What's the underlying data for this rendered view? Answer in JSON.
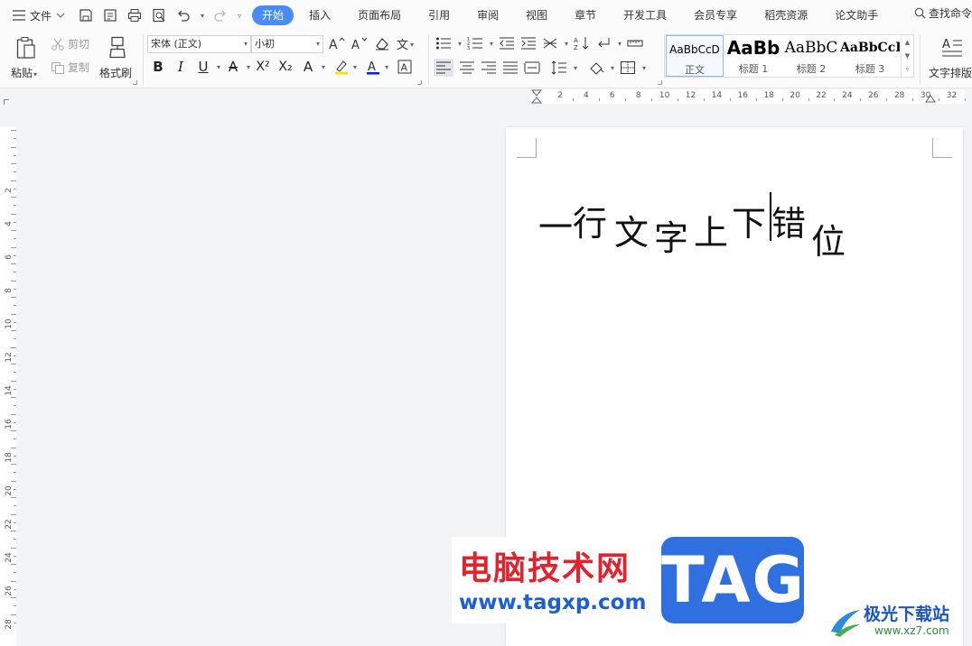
{
  "menu": {
    "file_label": "文件",
    "tabs": [
      "开始",
      "插入",
      "页面布局",
      "引用",
      "审阅",
      "视图",
      "章节",
      "开发工具",
      "会员专享",
      "稻壳资源",
      "论文助手"
    ],
    "search_label": "查找命令"
  },
  "ribbon": {
    "paste_label": "粘贴",
    "cut_label": "剪切",
    "copy_label": "复制",
    "format_painter_label": "格式刷",
    "font_name": "宋体 (正文)",
    "font_size": "小初",
    "styles": [
      {
        "sample": "AaBbCcD",
        "name": "正文"
      },
      {
        "sample": "AaBb",
        "name": "标题 1"
      },
      {
        "sample": "AaBbC",
        "name": "标题 2"
      },
      {
        "sample": "AaBbCcI",
        "name": "标题 3"
      }
    ],
    "text_layout_label": "文字排版"
  },
  "hruler_labels": [
    "2",
    "4",
    "6",
    "8",
    "10",
    "12",
    "14",
    "16",
    "18",
    "20",
    "22",
    "24",
    "26",
    "28",
    "30",
    "32"
  ],
  "vruler_labels": [
    "2",
    "4",
    "6",
    "8",
    "10",
    "12",
    "14",
    "16",
    "18",
    "20",
    "22",
    "24",
    "26",
    "28"
  ],
  "document": {
    "chars": [
      "一",
      "行",
      "文",
      "字",
      "上",
      "下",
      "错",
      "位"
    ]
  },
  "watermarks": {
    "site_cn": "电脑技术网",
    "site_url": "www.tagxp.com",
    "tag": "TAG",
    "site2_cn": "极光下载站",
    "site2_url": "www.xz7.com"
  }
}
